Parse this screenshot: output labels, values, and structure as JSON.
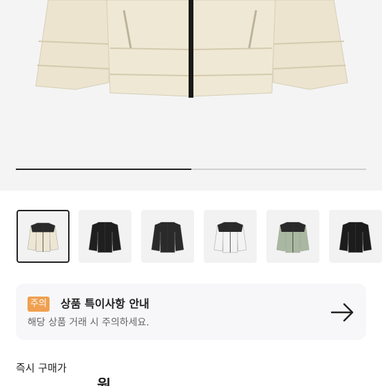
{
  "gallery": {
    "current_slide_fraction": 0.5,
    "thumbnails": [
      {
        "name": "cream-puffer-jacket",
        "color": "#ede6d3",
        "shoulder": "#2a2a2a",
        "active": true
      },
      {
        "name": "black-puffer-jacket",
        "color": "#1f1f1f",
        "shoulder": "#1f1f1f",
        "active": false
      },
      {
        "name": "glossy-black-puffer-jacket",
        "color": "#2a2a2a",
        "shoulder": "#2a2a2a",
        "active": false
      },
      {
        "name": "white-puffer-jacket",
        "color": "#f3f3f3",
        "shoulder": "#2a2a2a",
        "active": false
      },
      {
        "name": "sage-puffer-jacket",
        "color": "#a9b8a0",
        "shoulder": "#2a2a2a",
        "active": false
      },
      {
        "name": "black-puffer-jacket-2",
        "color": "#1c1c1c",
        "shoulder": "#1c1c1c",
        "active": false
      }
    ]
  },
  "notice": {
    "badge": "주의",
    "title": "상품 특이사항 안내",
    "subtitle": "해당 상품 거래 시 주의하세요.",
    "arrow_icon": "arrow-right-icon",
    "badge_color": "#f0a050"
  },
  "purchase": {
    "label": "즉시 구매가",
    "price_partial": "원"
  }
}
